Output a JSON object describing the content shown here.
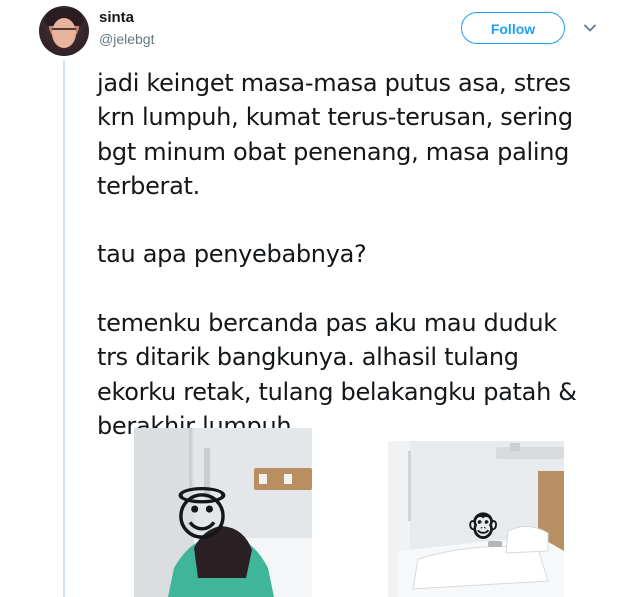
{
  "user": {
    "name": "sinta",
    "handle": "@jelebgt"
  },
  "follow": {
    "label": "Follow"
  },
  "tweet": {
    "paragraphs": [
      [
        "jadi keinget masa-masa putus asa, stres",
        "krn lumpuh, kumat terus-terusan, sering",
        "bgt minum obat penenang, masa paling",
        "terberat."
      ],
      [
        "tau apa penyebabnya?"
      ],
      [
        "temenku bercanda pas aku mau duduk",
        "trs ditarik bangkunya. alhasil tulang",
        "ekorku retak, tulang belakangku patah &",
        "berakhir lumpuh.."
      ]
    ]
  },
  "media": {
    "left_emoji": "😇",
    "right_emoji": "🐵"
  },
  "colors": {
    "accent": "#1da1f2",
    "text": "#14171a",
    "muted": "#657786",
    "thread_line": "#cce6f7"
  },
  "icons": {
    "menu": "chevron-down-icon"
  }
}
